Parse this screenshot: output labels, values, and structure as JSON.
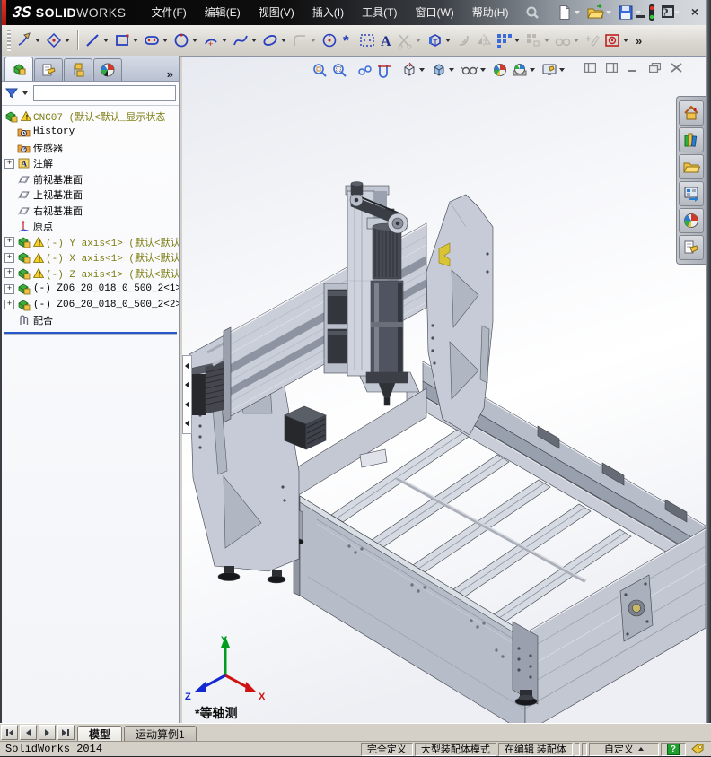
{
  "titlebar": {
    "brand": {
      "mark": "3S",
      "solid": "SOLID",
      "works": "WORKS"
    },
    "menus": [
      {
        "label": "文件(F)"
      },
      {
        "label": "编辑(E)"
      },
      {
        "label": "视图(V)"
      },
      {
        "label": "插入(I)"
      },
      {
        "label": "工具(T)"
      },
      {
        "label": "窗口(W)"
      },
      {
        "label": "帮助(H)"
      }
    ],
    "quick": [
      {
        "name": "new-document",
        "caret": true
      },
      {
        "name": "open-document",
        "caret": true
      },
      {
        "name": "save-document",
        "caret": true
      },
      {
        "name": "performance-lights",
        "caret": false
      },
      {
        "name": "help",
        "caret": true
      }
    ],
    "window_buttons": [
      {
        "name": "minimize"
      },
      {
        "name": "restore"
      },
      {
        "name": "close"
      }
    ]
  },
  "sketch_toolbar": [
    {
      "name": "sketch",
      "caret": true,
      "enabled": true
    },
    {
      "name": "smart-dimension",
      "caret": true,
      "enabled": true
    },
    {
      "name": "separator"
    },
    {
      "name": "line",
      "caret": true,
      "enabled": true
    },
    {
      "name": "corner-rectangle",
      "caret": true,
      "enabled": true
    },
    {
      "name": "straight-slot",
      "caret": true,
      "enabled": true
    },
    {
      "name": "circle",
      "caret": true,
      "enabled": true
    },
    {
      "name": "centerpoint-arc",
      "caret": true,
      "enabled": true
    },
    {
      "name": "spline",
      "caret": true,
      "enabled": true
    },
    {
      "name": "ellipse",
      "caret": true,
      "enabled": true
    },
    {
      "name": "sketch-fillet",
      "caret": true,
      "enabled": false
    },
    {
      "name": "polygon",
      "caret": false,
      "enabled": true
    },
    {
      "name": "point",
      "caret": false,
      "enabled": true
    },
    {
      "name": "surface-sketch",
      "caret": false,
      "enabled": true
    },
    {
      "name": "text",
      "caret": false,
      "enabled": true
    },
    {
      "name": "trim-entities",
      "caret": true,
      "enabled": false
    },
    {
      "name": "convert-entities",
      "caret": true,
      "enabled": true
    },
    {
      "name": "offset-entities",
      "caret": false,
      "enabled": false
    },
    {
      "name": "mirror-entities",
      "caret": false,
      "enabled": false
    },
    {
      "name": "linear-sketch-pattern",
      "caret": true,
      "enabled": true
    },
    {
      "name": "move-entities",
      "caret": true,
      "enabled": false
    },
    {
      "name": "display-relations",
      "caret": true,
      "enabled": false
    },
    {
      "name": "add-relation",
      "caret": false,
      "enabled": false
    },
    {
      "name": "reference-point",
      "caret": true,
      "enabled": true
    },
    {
      "name": "overflow",
      "label": "»"
    }
  ],
  "left_panel": {
    "tabs": [
      {
        "name": "featuremanager",
        "active": true
      },
      {
        "name": "propertymanager",
        "active": false
      },
      {
        "name": "configurationmanager",
        "active": false
      },
      {
        "name": "displaymanager",
        "active": false
      }
    ],
    "overflow": "»",
    "filter": {
      "value": ""
    },
    "tree": [
      {
        "label": "CNC07  (默认<默认_显示状态",
        "icon": "assembly-root",
        "warning": true,
        "expander": false,
        "indent": 0,
        "olive": true
      },
      {
        "label": "History",
        "icon": "history-folder",
        "warning": false,
        "expander": false,
        "indent": 1,
        "olive": false
      },
      {
        "label": "传感器",
        "icon": "sensors-folder",
        "warning": false,
        "expander": false,
        "indent": 1,
        "olive": false
      },
      {
        "label": "注解",
        "icon": "annotations",
        "warning": false,
        "expander": true,
        "indent": 1,
        "olive": false
      },
      {
        "label": "前视基准面",
        "icon": "plane",
        "warning": false,
        "expander": false,
        "indent": 1,
        "olive": false
      },
      {
        "label": "上视基准面",
        "icon": "plane",
        "warning": false,
        "expander": false,
        "indent": 1,
        "olive": false
      },
      {
        "label": "右视基准面",
        "icon": "plane",
        "warning": false,
        "expander": false,
        "indent": 1,
        "olive": false
      },
      {
        "label": "原点",
        "icon": "origin",
        "warning": false,
        "expander": false,
        "indent": 1,
        "olive": false
      },
      {
        "label": "(-) Y axis<1> (默认<默认",
        "icon": "assembly",
        "warning": true,
        "expander": true,
        "indent": 1,
        "olive": true
      },
      {
        "label": "(-) X axis<1> (默认<默认",
        "icon": "assembly",
        "warning": true,
        "expander": true,
        "indent": 1,
        "olive": true
      },
      {
        "label": "(-) Z axis<1> (默认<默认",
        "icon": "assembly",
        "warning": true,
        "expander": true,
        "indent": 1,
        "olive": true
      },
      {
        "label": "(-) Z06_20_018_0_500_2<1>",
        "icon": "assembly",
        "warning": false,
        "expander": true,
        "indent": 1,
        "olive": false
      },
      {
        "label": "(-) Z06_20_018_0_500_2<2>",
        "icon": "assembly",
        "warning": false,
        "expander": true,
        "indent": 1,
        "olive": false
      },
      {
        "label": "配合",
        "icon": "mates",
        "warning": false,
        "expander": false,
        "indent": 1,
        "olive": false
      }
    ]
  },
  "headsup": [
    {
      "name": "zoom-to-fit",
      "caret": false
    },
    {
      "name": "zoom-to-area",
      "caret": false
    },
    {
      "name": "previous-view",
      "caret": false
    },
    {
      "name": "section-view",
      "caret": false
    },
    {
      "name": "view-orientation",
      "caret": true
    },
    {
      "name": "display-style",
      "caret": true
    },
    {
      "name": "hide-show-items",
      "caret": true
    },
    {
      "name": "edit-appearance",
      "caret": false
    },
    {
      "name": "apply-scene",
      "caret": true
    },
    {
      "name": "view-settings",
      "caret": true
    }
  ],
  "mdi_buttons": [
    {
      "name": "pane-left"
    },
    {
      "name": "pane-right"
    },
    {
      "name": "child-minimize"
    },
    {
      "name": "child-restore"
    },
    {
      "name": "child-close"
    }
  ],
  "task_pane": [
    {
      "name": "solidworks-resources"
    },
    {
      "name": "design-library"
    },
    {
      "name": "file-explorer"
    },
    {
      "name": "view-palette"
    },
    {
      "name": "appearances-scenes"
    },
    {
      "name": "custom-properties"
    }
  ],
  "viewport": {
    "view_label": "*等轴测",
    "triad": {
      "x": "X",
      "y": "Y",
      "z": "Z"
    },
    "triad_colors": {
      "x": "#d01212",
      "y": "#009c1e",
      "z": "#1428d2"
    }
  },
  "bottom_tabs": {
    "nav": [
      {
        "name": "first"
      },
      {
        "name": "previous"
      },
      {
        "name": "next"
      },
      {
        "name": "last"
      }
    ],
    "tabs": [
      {
        "label": "模型",
        "active": true
      },
      {
        "label": "运动算例1",
        "active": false
      }
    ]
  },
  "statusbar": {
    "app": "SolidWorks 2014",
    "cells": [
      {
        "name": "definition-status",
        "label": "完全定义"
      },
      {
        "name": "assembly-mode",
        "label": "大型装配体模式"
      },
      {
        "name": "edit-status",
        "label": "在编辑 装配体"
      }
    ],
    "custom": "自定义",
    "help": "?"
  }
}
